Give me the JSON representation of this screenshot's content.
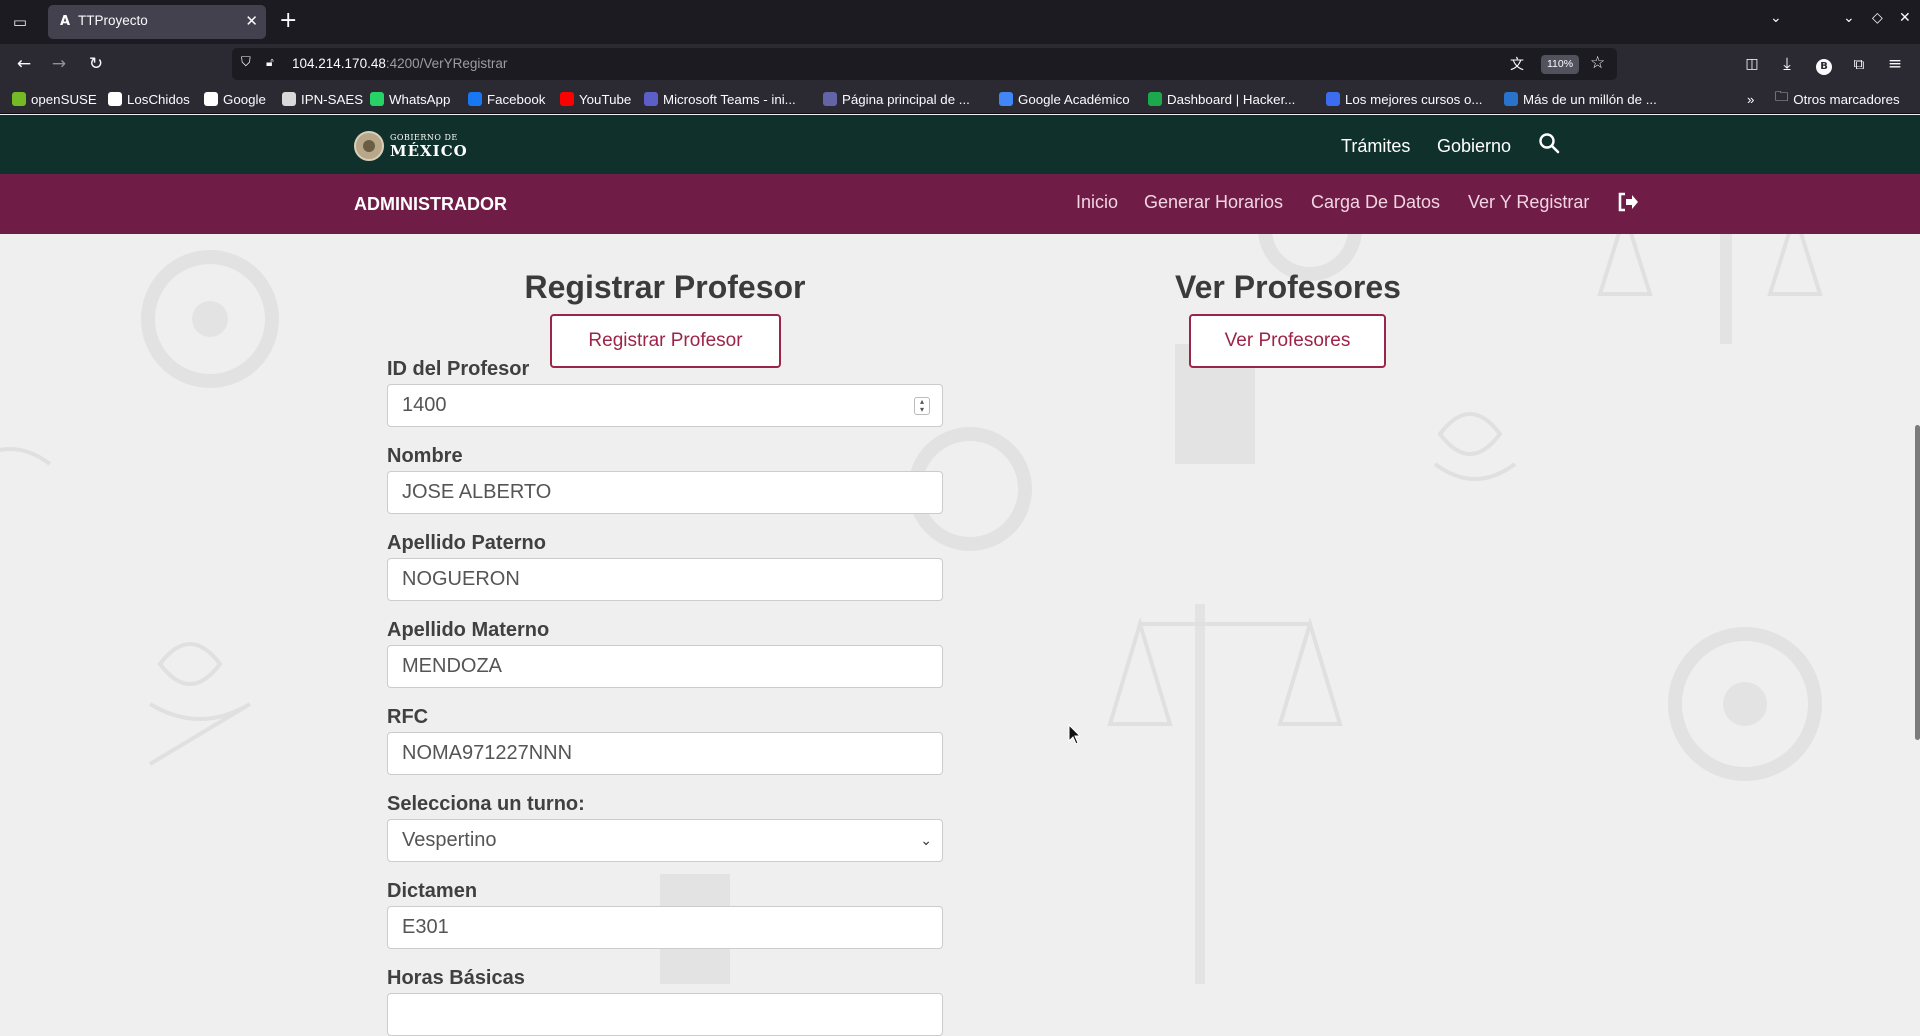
{
  "browser": {
    "tab_title": "TTProyecto",
    "tab_favicon": "A",
    "url_host": "104.214.170.48",
    "url_rest": ":4200/VerYRegistrar",
    "zoom": "110%",
    "bookmarks": [
      {
        "label": "openSUSE",
        "icon": "opensuse-icon",
        "color": "#73ba25"
      },
      {
        "label": "LosChidos",
        "icon": "github-icon",
        "color": "#ffffff"
      },
      {
        "label": "Google",
        "icon": "google-icon",
        "color": "#ffffff"
      },
      {
        "label": "IPN-SAES",
        "icon": "ipn-icon",
        "color": "#d9d9d9"
      },
      {
        "label": "WhatsApp",
        "icon": "whatsapp-icon",
        "color": "#25d366"
      },
      {
        "label": "Facebook",
        "icon": "facebook-icon",
        "color": "#1877f2"
      },
      {
        "label": "YouTube",
        "icon": "youtube-icon",
        "color": "#ff0000"
      },
      {
        "label": "Microsoft Teams - ini...",
        "icon": "teams-icon",
        "color": "#5b5fc7"
      },
      {
        "label": "Página principal de ...",
        "icon": "page-icon",
        "color": "#6264a7"
      },
      {
        "label": "Google Académico",
        "icon": "scholar-icon",
        "color": "#4285f4"
      },
      {
        "label": "Dashboard | Hacker...",
        "icon": "hackerrank-icon",
        "color": "#1ba94c"
      },
      {
        "label": "Los mejores cursos o...",
        "icon": "courses-icon",
        "color": "#3c6df0"
      },
      {
        "label": "Más de un millón de ...",
        "icon": "coursera-icon",
        "color": "#2a73cc"
      }
    ],
    "other_bookmarks": "Otros marcadores"
  },
  "gob_header": {
    "logo_line1": "GOBIERNO DE",
    "logo_line2": "MÉXICO",
    "links": [
      "Trámites",
      "Gobierno"
    ]
  },
  "admin_bar": {
    "title": "ADMINISTRADOR",
    "links": [
      "Inicio",
      "Generar Horarios",
      "Carga De Datos",
      "Ver Y Registrar"
    ]
  },
  "register": {
    "title": "Registrar Profesor",
    "button": "Registrar Profesor"
  },
  "view": {
    "title": "Ver Profesores",
    "button": "Ver Profesores"
  },
  "form": {
    "id_label": "ID del Profesor",
    "id_value": "1400",
    "nombre_label": "Nombre",
    "nombre_value": "JOSE ALBERTO",
    "paterno_label": "Apellido Paterno",
    "paterno_value": "NOGUERON",
    "materno_label": "Apellido Materno",
    "materno_value": "MENDOZA",
    "rfc_label": "RFC",
    "rfc_value": "NOMA971227NNN",
    "turno_label": "Selecciona un turno:",
    "turno_value": "Vespertino",
    "dictamen_label": "Dictamen",
    "dictamen_value": "E301",
    "horas_label": "Horas Básicas"
  },
  "colors": {
    "gob_green": "#10312b",
    "admin_maroon": "#6f1d46",
    "accent": "#9d2449"
  }
}
